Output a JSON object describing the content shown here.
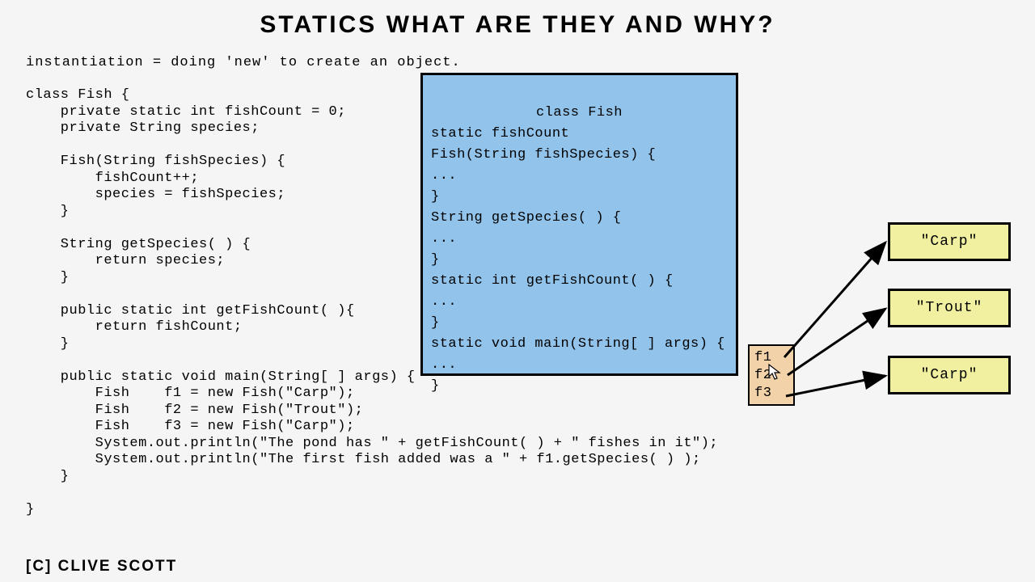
{
  "title": "STATICS WHAT ARE THEY AND WHY?",
  "subtitle": "instantiation = doing 'new' to create an object.",
  "code": "class Fish {\n    private static int fishCount = 0;\n    private String species;\n\n    Fish(String fishSpecies) {\n        fishCount++;\n        species = fishSpecies;\n    }\n\n    String getSpecies( ) {\n        return species;\n    }\n\n    public static int getFishCount( ){\n        return fishCount;\n    }\n\n    public static void main(String[ ] args) {\n        Fish    f1 = new Fish(\"Carp\");\n        Fish    f2 = new Fish(\"Trout\");\n        Fish    f3 = new Fish(\"Carp\");\n        System.out.println(\"The pond has \" + getFishCount( ) + \" fishes in it\");\n        System.out.println(\"The first fish added was a \" + f1.getSpecies( ) );\n    }\n\n}",
  "bluebox": {
    "header": "class Fish",
    "body": "static fishCount\nFish(String fishSpecies) {\n...\n}\nString getSpecies( ) {\n...\n}\nstatic int getFishCount( ) {\n...\n}\nstatic void main(String[ ] args) {\n...\n}"
  },
  "refs": {
    "r1": "f1",
    "r2": "f2",
    "r3": "f3"
  },
  "instances": {
    "i1": "\"Carp\"",
    "i2": "\"Trout\"",
    "i3": "\"Carp\""
  },
  "footer": "[C] CLIVE SCOTT"
}
